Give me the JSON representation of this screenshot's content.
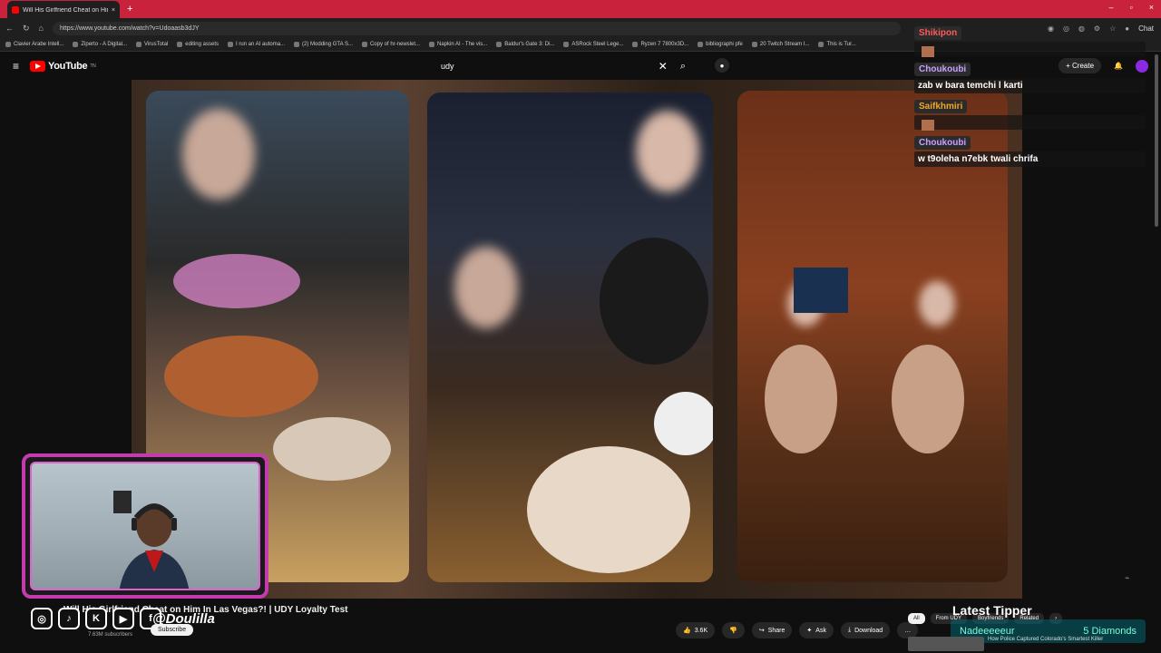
{
  "browser": {
    "tab_title": "Will His Girlfriend Cheat on Him I...",
    "tab_close": "×",
    "new_tab": "+",
    "window_controls": [
      "–",
      "▫",
      "×"
    ],
    "url": "https://www.youtube.com/watch?v=Udoaasb3dJY",
    "nav": [
      "←",
      "↻",
      "⌂"
    ],
    "ext_chat": "Chat",
    "bookmarks": [
      "Clavier Arabe Intell...",
      "Ziperto - A Digital...",
      "VirusTotal",
      "editing assets",
      "I run an AI automa...",
      "(2) Modding GTA S...",
      "Copy of hr-newslet...",
      "Napkin AI - The vis...",
      "Baldur's Gate 3: Di...",
      "ASRock Steel Lege...",
      "Ryzen 7 7800x3D...",
      "bibliographi pfe",
      "20 Twitch Stream I...",
      "This is Tur..."
    ]
  },
  "youtube": {
    "menu_icon": "≡",
    "logo_text": "YouTube",
    "logo_sup": "TN",
    "search_query": "udy",
    "clear": "✕",
    "search_icon": "⌕",
    "mic_icon": "●",
    "create_label": "+ Create",
    "bell": "🔔"
  },
  "chat_overlay": [
    {
      "name": "Shikipon",
      "name_color": "#ff5a5a",
      "message": "",
      "emote": true
    },
    {
      "name": "Choukoubi",
      "name_color": "#c9a0ff",
      "message": "zab w bara temchi l karti",
      "emote": false
    },
    {
      "name": "Saifkhmiri",
      "name_color": "#f5a623",
      "message": "",
      "emote": true
    },
    {
      "name": "Choukoubi",
      "name_color": "#c9a0ff",
      "message": "w t9oleha n7ebk twali chrifa",
      "emote": false
    }
  ],
  "video": {
    "title": "Will His Girlfriend Cheat on Him In Las Vegas?! | UDY Loyalty Test",
    "handle": "@Doulilla",
    "subscribers": "7.63M subscribers",
    "subscribe_label": "Subscribe",
    "likes": "3.6K",
    "share": "Share",
    "ask": "Ask",
    "download": "Download",
    "more": "…",
    "social": [
      "◎",
      "♪",
      "K",
      "▶",
      "f"
    ]
  },
  "chips": [
    "All",
    "From UDY",
    "Boyfriends",
    "Related",
    "›"
  ],
  "tipper": {
    "title": "Latest Tipper",
    "name": "Nadeeeeeur",
    "amount": "5 Diamonds"
  },
  "related": {
    "title": "How Police Captured Colorado's Smartest Killer"
  },
  "watermark": "⌁"
}
